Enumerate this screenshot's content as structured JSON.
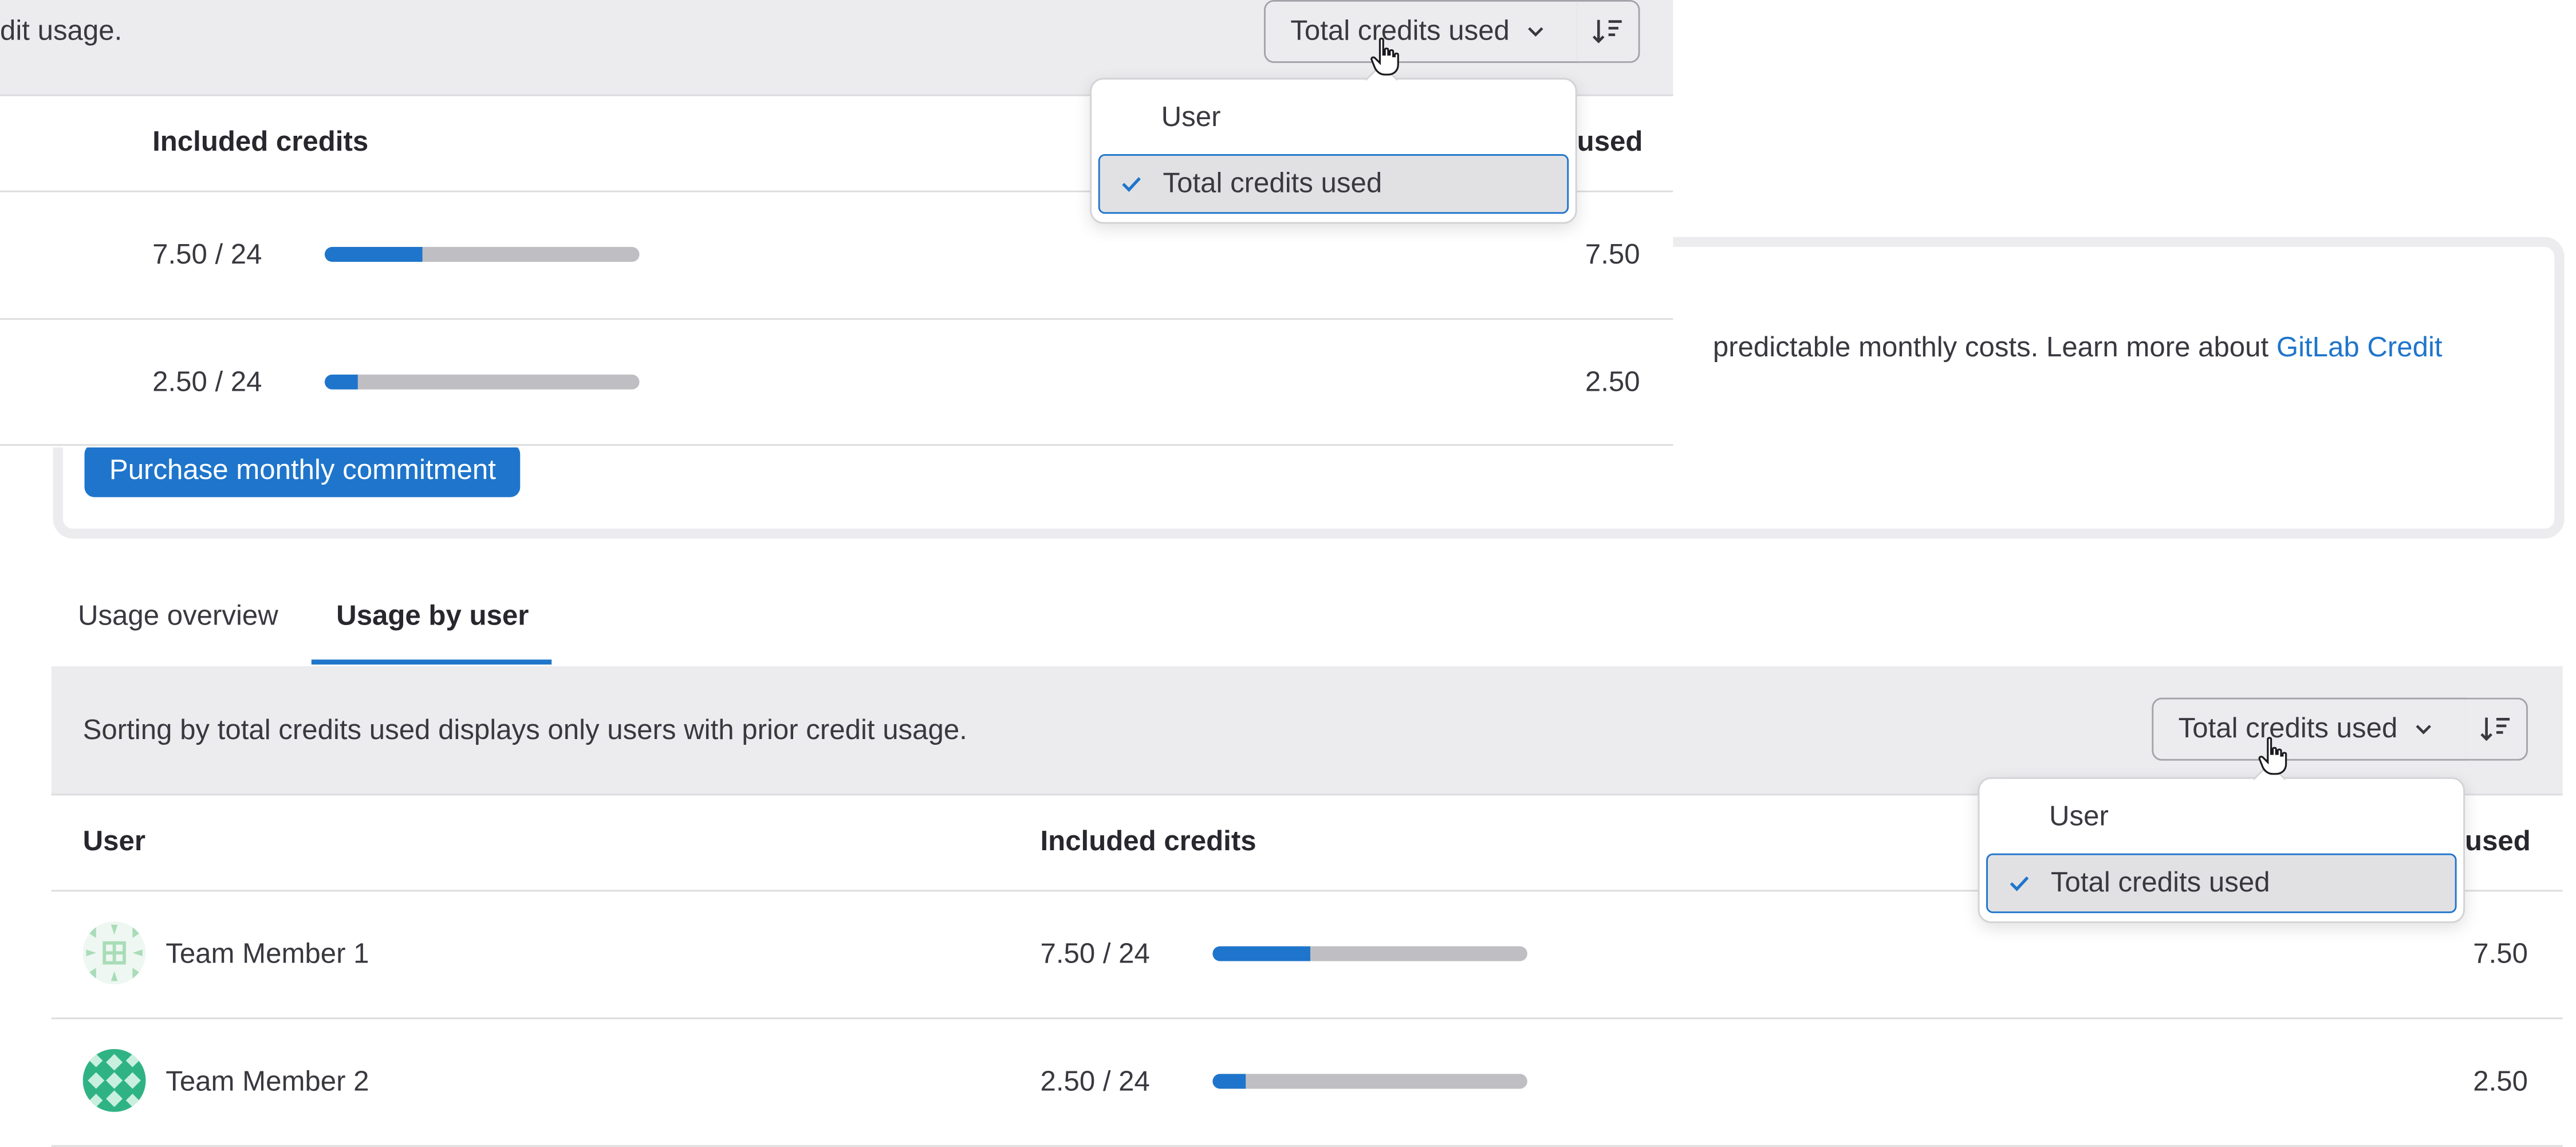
{
  "overlay_view": {
    "sort_note_fragment": "dit usage.",
    "sort_button_label": "Total credits used",
    "headers": {
      "included": "Included credits",
      "used_fragment": "used"
    },
    "rows": [
      {
        "included": "7.50 / 24",
        "progress": 0.3125,
        "used": "7.50"
      },
      {
        "included": "2.50 / 24",
        "progress": 0.104,
        "used": "2.50"
      }
    ],
    "dropdown": {
      "options": [
        "User",
        "Total credits used"
      ],
      "selected": "Total credits used"
    }
  },
  "promo": {
    "text": "predictable monthly costs. Learn more about ",
    "link": "GitLab Credit",
    "button": "Purchase monthly commitment"
  },
  "tabs": [
    {
      "label": "Usage overview",
      "active": false
    },
    {
      "label": "Usage by user",
      "active": true
    }
  ],
  "usage_by_user": {
    "sort_note": "Sorting by total credits used displays only users with prior credit usage.",
    "sort_button_label": "Total credits used",
    "headers": {
      "user": "User",
      "included": "Included credits",
      "used_fragment": "used"
    },
    "rows": [
      {
        "name": "Team Member 1",
        "included": "7.50 / 24",
        "progress": 0.3125,
        "used": "7.50",
        "avatar_color": "#a9dcb8"
      },
      {
        "name": "Team Member 2",
        "included": "2.50 / 24",
        "progress": 0.104,
        "used": "2.50",
        "avatar_color": "#2fb385"
      }
    ],
    "dropdown": {
      "options": [
        "User",
        "Total credits used"
      ],
      "selected": "Total credits used"
    }
  },
  "colors": {
    "accent": "#1f75cb",
    "bar_track": "#bfbfc3",
    "sortbar_bg": "#ececef"
  },
  "icons": [
    "chevron-down-icon",
    "sort-descending-icon",
    "pointer-cursor-icon",
    "check-icon"
  ]
}
